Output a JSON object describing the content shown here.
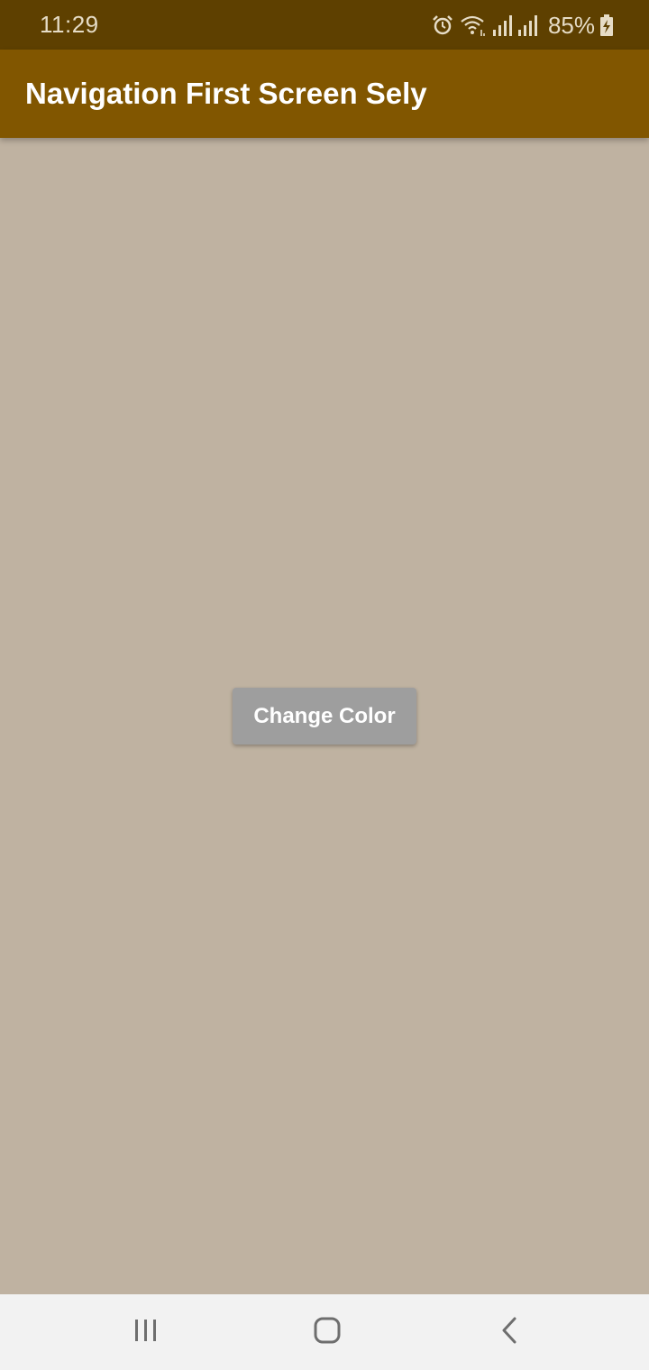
{
  "status_bar": {
    "time": "11:29",
    "battery": "85%",
    "icons": [
      "alarm-icon",
      "wifi-icon",
      "signal-icon",
      "signal-icon",
      "battery-charging-icon"
    ]
  },
  "app_bar": {
    "title": "Navigation First Screen Sely"
  },
  "main": {
    "button_label": "Change Color"
  },
  "nav_bar": {
    "buttons": [
      "recent-apps",
      "home",
      "back"
    ]
  },
  "colors": {
    "status_bar": "#5e4000",
    "app_bar": "#815600",
    "background": "#bfb2a1",
    "button": "#9e9e9e",
    "nav_bar": "#f2f2f2"
  }
}
